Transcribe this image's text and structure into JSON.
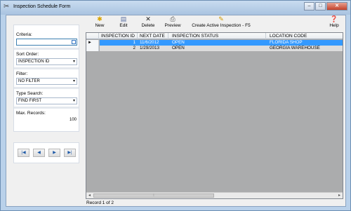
{
  "window": {
    "title": "Inspection Schedule Form"
  },
  "left_panel": {
    "criteria_label": "Criteria:",
    "criteria_value": "",
    "sort_order_label": "Sort Order:",
    "sort_order_value": "INSPECTION ID",
    "filter_label": "Filter:",
    "filter_value": "NO FILTER",
    "type_search_label": "Type Search:",
    "type_search_value": "FIND FIRST",
    "max_records_label": "Max. Records:",
    "max_records_value": "100"
  },
  "toolbar": {
    "new_label": "New",
    "edit_label": "Edit",
    "delete_label": "Delete",
    "preview_label": "Preview",
    "create_label": "Create Active Inspection - F5",
    "help_label": "Help"
  },
  "grid": {
    "columns": [
      "INSPECTION ID",
      "NEXT DATE",
      "INSPECTION STATUS",
      "LOCATION CODE"
    ],
    "rows": [
      {
        "id": "1",
        "next_date": "11/6/2012",
        "status": "OPEN",
        "location": "FLORIDA SHOP"
      },
      {
        "id": "2",
        "next_date": "1/29/2013",
        "status": "OPEN",
        "location": "GEORGIA WAREHOUSE"
      }
    ],
    "current_row_marker": "►"
  },
  "status_bar": {
    "text": "Record 1 of 2"
  },
  "colors": {
    "selection": "#3399ff",
    "grid_background": "#abacad",
    "frame": "#b9d1ea"
  }
}
